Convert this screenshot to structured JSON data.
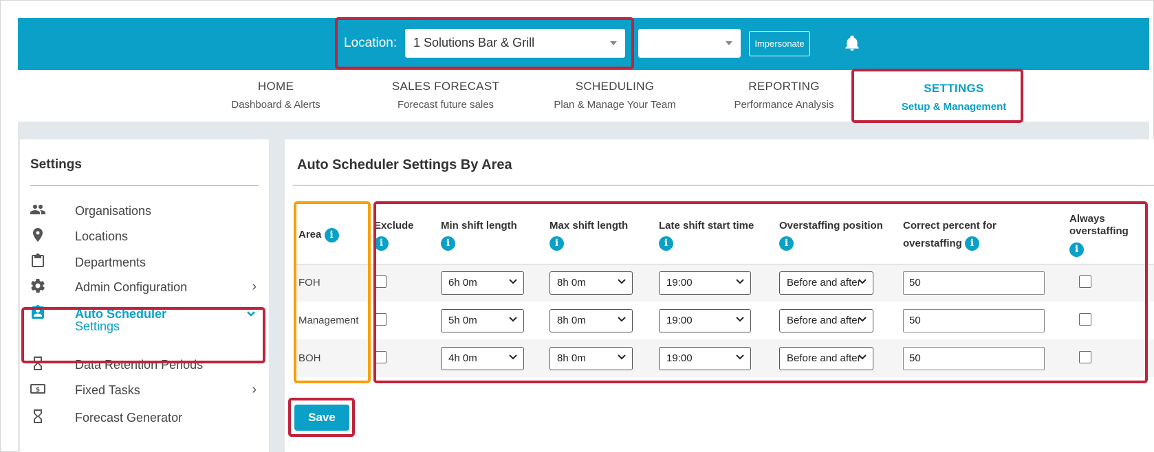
{
  "header": {
    "location_label": "Location:",
    "location_value": "1 Solutions Bar & Grill",
    "secondary_select_value": "",
    "impersonate_label": "Impersonate",
    "accent_color": "#0aa0c8"
  },
  "nav": [
    {
      "title": "HOME",
      "sub": "Dashboard & Alerts"
    },
    {
      "title": "SALES FORECAST",
      "sub": "Forecast future sales"
    },
    {
      "title": "SCHEDULING",
      "sub": "Plan & Manage Your Team"
    },
    {
      "title": "REPORTING",
      "sub": "Performance Analysis"
    },
    {
      "title": "SETTINGS",
      "sub": "Setup & Management",
      "active": true
    }
  ],
  "sidebar": {
    "title": "Settings",
    "items": [
      {
        "label": "Organisations",
        "icon": "people-icon"
      },
      {
        "label": "Locations",
        "icon": "location-pin-icon"
      },
      {
        "label": "Departments",
        "icon": "clipboard-icon"
      },
      {
        "label": "Admin Configuration",
        "icon": "gear-icon",
        "arrow": "›"
      },
      {
        "label": "Auto Scheduler",
        "icon": "badge-icon",
        "arrow": "⌄",
        "active": true,
        "sub": "Settings"
      },
      {
        "label": "Data Retention Periods",
        "icon": "hourglass-icon"
      },
      {
        "label": "Fixed Tasks",
        "icon": "dollar-bill-icon",
        "arrow": "›"
      },
      {
        "label": "Forecast Generator",
        "icon": "hourglass-icon"
      }
    ]
  },
  "main": {
    "title": "Auto Scheduler Settings By Area",
    "columns": {
      "area": "Area",
      "exclude": "Exclude",
      "min_shift": "Min shift length",
      "max_shift": "Max shift length",
      "late_shift": "Late shift start time",
      "overstaffing_position": "Overstaffing position",
      "correct_percent_1": "Correct percent for",
      "correct_percent_2": "overstaffing",
      "always_1": "Always",
      "always_2": "overstaffing"
    },
    "rows": [
      {
        "area": "FOH",
        "exclude": false,
        "min": "6h 0m",
        "max": "8h 0m",
        "late": "19:00",
        "position": "Before and after",
        "percent": "50",
        "always": false
      },
      {
        "area": "Management",
        "exclude": false,
        "min": "5h 0m",
        "max": "8h 0m",
        "late": "19:00",
        "position": "Before and after",
        "percent": "50",
        "always": false
      },
      {
        "area": "BOH",
        "exclude": false,
        "min": "4h 0m",
        "max": "8h 0m",
        "late": "19:00",
        "position": "Before and after",
        "percent": "50",
        "always": false
      }
    ],
    "save_label": "Save"
  }
}
